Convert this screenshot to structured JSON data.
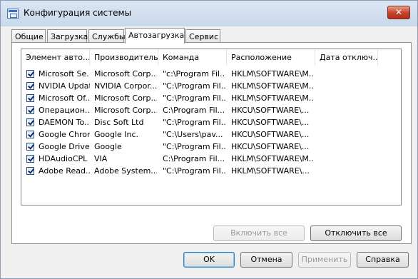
{
  "window": {
    "title": "Конфигурация системы",
    "close_glyph": "✕"
  },
  "tabs": [
    {
      "label": "Общие"
    },
    {
      "label": "Загрузка"
    },
    {
      "label": "Службы"
    },
    {
      "label": "Автозагрузка",
      "active": true
    },
    {
      "label": "Сервис"
    }
  ],
  "table": {
    "columns": [
      "Элемент авто...",
      "Производитель",
      "Команда",
      "Расположение",
      "Дата отключ..."
    ],
    "rows": [
      {
        "checked": true,
        "item": "Microsoft Se...",
        "vendor": "Microsoft Corp...",
        "command": "\"c:\\Program Fil...",
        "location": "HKLM\\SOFTWARE\\M...",
        "date": ""
      },
      {
        "checked": true,
        "item": "NVIDIA Update",
        "vendor": "NVIDIA Corpor...",
        "command": "\"C:\\Program Fil...",
        "location": "HKLM\\SOFTWARE\\M...",
        "date": ""
      },
      {
        "checked": true,
        "item": "Microsoft Of...",
        "vendor": "Microsoft Corp...",
        "command": "\"C:\\Program Fil...",
        "location": "HKLM\\SOFTWARE\\M...",
        "date": ""
      },
      {
        "checked": true,
        "item": "Операцион...",
        "vendor": "Microsoft Corp...",
        "command": "C:\\Program Fil...",
        "location": "HKCU\\SOFTWARE\\...",
        "date": ""
      },
      {
        "checked": true,
        "item": "DAEMON To...",
        "vendor": "Disc Soft Ltd",
        "command": "\"C:\\Program Fil...",
        "location": "HKCU\\SOFTWARE\\...",
        "date": ""
      },
      {
        "checked": true,
        "item": "Google Chrome",
        "vendor": "Google Inc.",
        "command": "\"C:\\Users\\pav...",
        "location": "HKCU\\SOFTWARE\\...",
        "date": ""
      },
      {
        "checked": true,
        "item": "Google Drive",
        "vendor": "Google",
        "command": "\"C:\\Program Fil...",
        "location": "HKCU\\SOFTWARE\\...",
        "date": ""
      },
      {
        "checked": true,
        "item": "HDAudioCPL",
        "vendor": "VIA",
        "command": "C:\\Program Fil...",
        "location": "HKLM\\SOFTWARE\\M...",
        "date": ""
      },
      {
        "checked": true,
        "item": "Adobe Read...",
        "vendor": "Adobe System...",
        "command": "\"C:\\Program Fil...",
        "location": "HKLM\\SOFTWARE\\...",
        "date": ""
      }
    ]
  },
  "panel_buttons": {
    "enable_all": "Включить все",
    "disable_all": "Отключить все"
  },
  "dialog_buttons": {
    "ok": "OK",
    "cancel": "Отмена",
    "apply": "Применить",
    "help": "Справка"
  }
}
